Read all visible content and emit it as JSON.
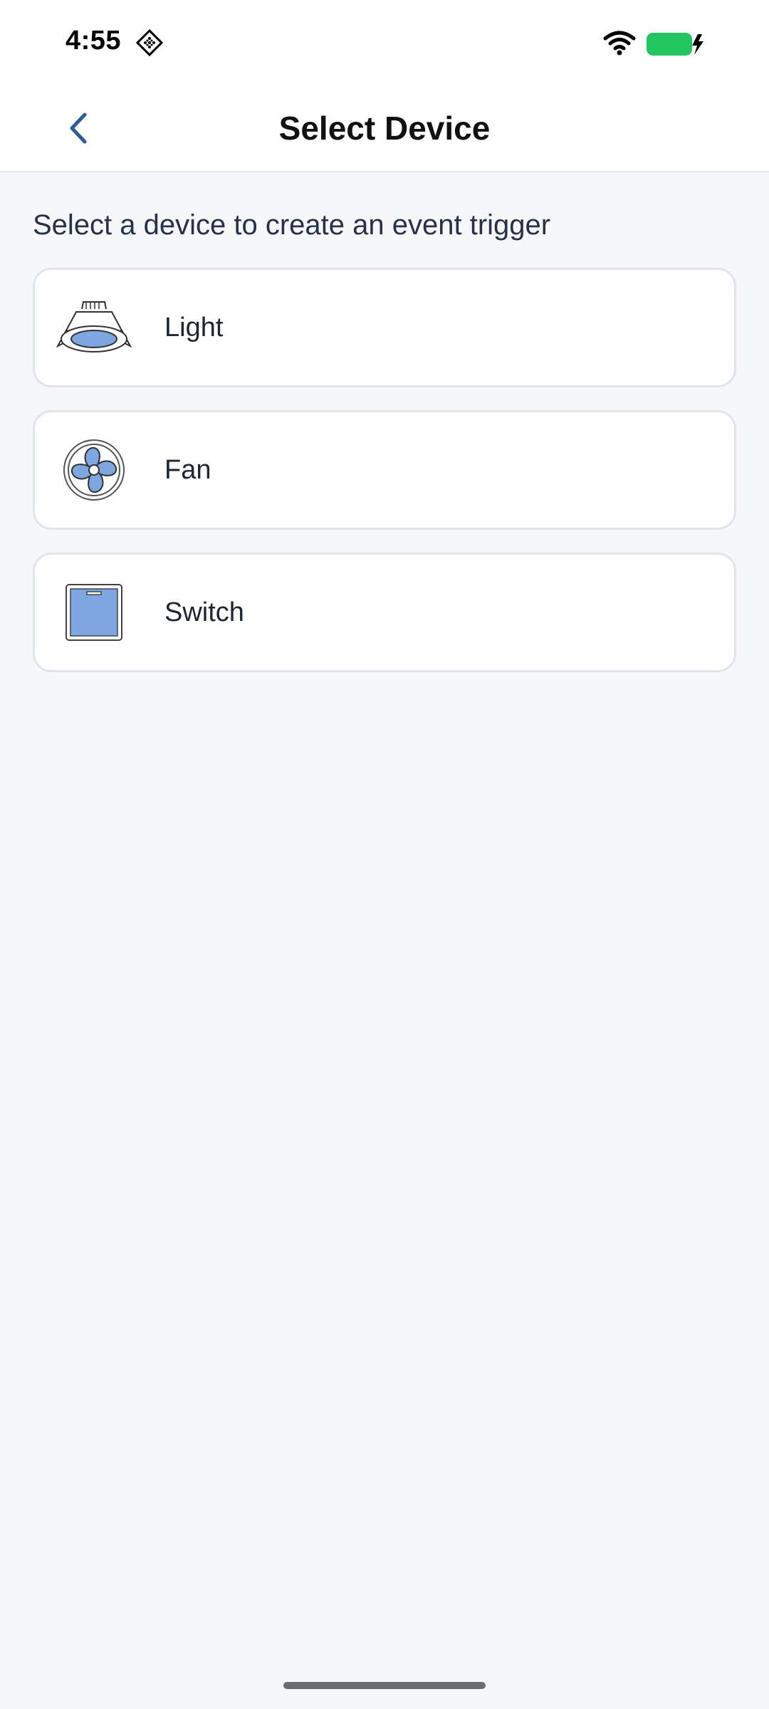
{
  "status_bar": {
    "time": "4:55",
    "icons": [
      "notification-icon",
      "wifi-icon",
      "battery-charging-icon"
    ],
    "battery_color": "#22c55e"
  },
  "header": {
    "title": "Select Device",
    "back_icon": "chevron-left-icon",
    "accent_color": "#2f5b9a"
  },
  "instruction": "Select a device to create an event trigger",
  "devices": [
    {
      "label": "Light",
      "icon": "light-icon"
    },
    {
      "label": "Fan",
      "icon": "fan-icon"
    },
    {
      "label": "Switch",
      "icon": "switch-icon"
    }
  ],
  "icon_fill_color": "#7ea6e0"
}
